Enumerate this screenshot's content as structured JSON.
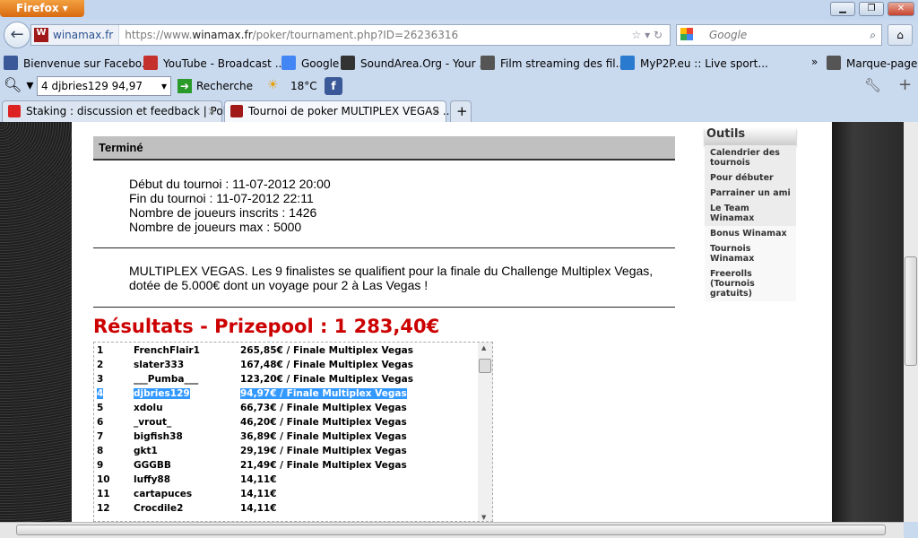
{
  "browser": {
    "menu_button": "Firefox",
    "site_identity": "winamax.fr",
    "url_prefix": "https://www.",
    "url_domain": "winamax.fr",
    "url_path": "/poker/tournament.php?ID=26236316",
    "search_placeholder": "Google"
  },
  "bookmarks": [
    {
      "label": "Bienvenue sur Facebo...",
      "icon": "facebook-icon",
      "color": "#3b5998"
    },
    {
      "label": "YouTube - Broadcast ...",
      "icon": "youtube-icon",
      "color": "#c4302b"
    },
    {
      "label": "Google",
      "icon": "google-icon",
      "color": "#4285f4"
    },
    {
      "label": "SoundArea.Org - Your ...",
      "icon": "soundarea-icon",
      "color": "#333333"
    },
    {
      "label": "Film streaming des fil...",
      "icon": "star-icon",
      "color": "#555555"
    },
    {
      "label": "MyP2P.eu :: Live sport...",
      "icon": "myp2p-icon",
      "color": "#2a7ad0"
    }
  ],
  "bookmarks_overflow": "»",
  "bookmarks_menu": "Marque-pages",
  "toolbar": {
    "combo_value": "4       djbries129       94,97",
    "search_label": "Recherche",
    "weather": "18°C"
  },
  "tabs": [
    {
      "label": "Staking : discussion et feedback | Pok..."
    },
    {
      "label": "Tournoi de poker MULTIPLEX VEGAS ..."
    }
  ],
  "tournament": {
    "status": "Terminé",
    "start": "Début du tournoi : 11-07-2012 20:00",
    "end": "Fin du tournoi : 11-07-2012 22:11",
    "registered": "Nombre de joueurs inscrits : 1426",
    "max": "Nombre de joueurs max : 5000",
    "description": "MULTIPLEX VEGAS. Les 9 finalistes se qualifient pour la finale du Challenge Multiplex Vegas, dotée de 5.000€ dont un voyage pour 2 à Las Vegas !",
    "results_title": "Résultats - Prizepool : 1 283,40€"
  },
  "results": [
    {
      "rank": "1",
      "player": "FrenchFlair1",
      "prize": "265,85€ / Finale Multiplex Vegas"
    },
    {
      "rank": "2",
      "player": "slater333",
      "prize": "167,48€ / Finale Multiplex Vegas"
    },
    {
      "rank": "3",
      "player": "___Pumba___",
      "prize": "123,20€ / Finale Multiplex Vegas"
    },
    {
      "rank": "4",
      "player": "djbries129",
      "prize": "94,97€ / Finale Multiplex Vegas"
    },
    {
      "rank": "5",
      "player": "xdolu",
      "prize": "66,73€ / Finale Multiplex Vegas"
    },
    {
      "rank": "6",
      "player": "_vrout_",
      "prize": "46,20€ / Finale Multiplex Vegas"
    },
    {
      "rank": "7",
      "player": "bigfish38",
      "prize": "36,89€ / Finale Multiplex Vegas"
    },
    {
      "rank": "8",
      "player": "gkt1",
      "prize": "29,19€ / Finale Multiplex Vegas"
    },
    {
      "rank": "9",
      "player": "GGGBB",
      "prize": "21,49€ / Finale Multiplex Vegas"
    },
    {
      "rank": "10",
      "player": "luffy88",
      "prize": "14,11€"
    },
    {
      "rank": "11",
      "player": "cartapuces",
      "prize": "14,11€"
    },
    {
      "rank": "12",
      "player": "Crocdile2",
      "prize": "14,11€"
    }
  ],
  "sidebar": {
    "title": "Outils",
    "items": [
      "Calendrier des tournois",
      "Pour débuter",
      "Parrainer un ami",
      "Le Team Winamax",
      "Bonus Winamax",
      "Tournois Winamax",
      "Freerolls (Tournois gratuits)"
    ]
  }
}
